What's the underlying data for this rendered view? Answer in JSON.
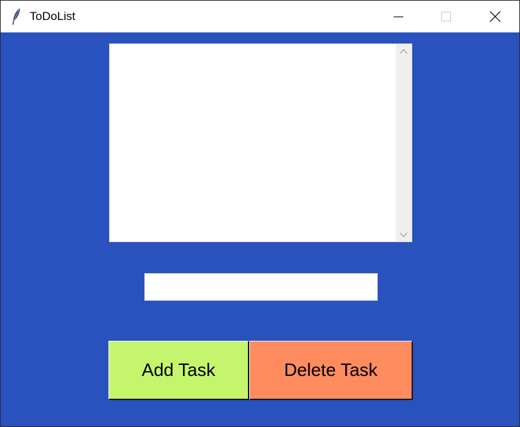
{
  "window": {
    "title": "ToDoList",
    "icon": "feather-icon",
    "controls": {
      "minimize_icon": "minimize-icon",
      "maximize_icon": "maximize-icon",
      "close_icon": "close-icon"
    }
  },
  "task_list": {
    "items": []
  },
  "task_input": {
    "value": "",
    "placeholder": ""
  },
  "buttons": {
    "add_label": "Add Task",
    "delete_label": "Delete Task"
  },
  "colors": {
    "background": "#2952bf",
    "add_button": "#c5f56d",
    "delete_button": "#ff8c5e"
  }
}
